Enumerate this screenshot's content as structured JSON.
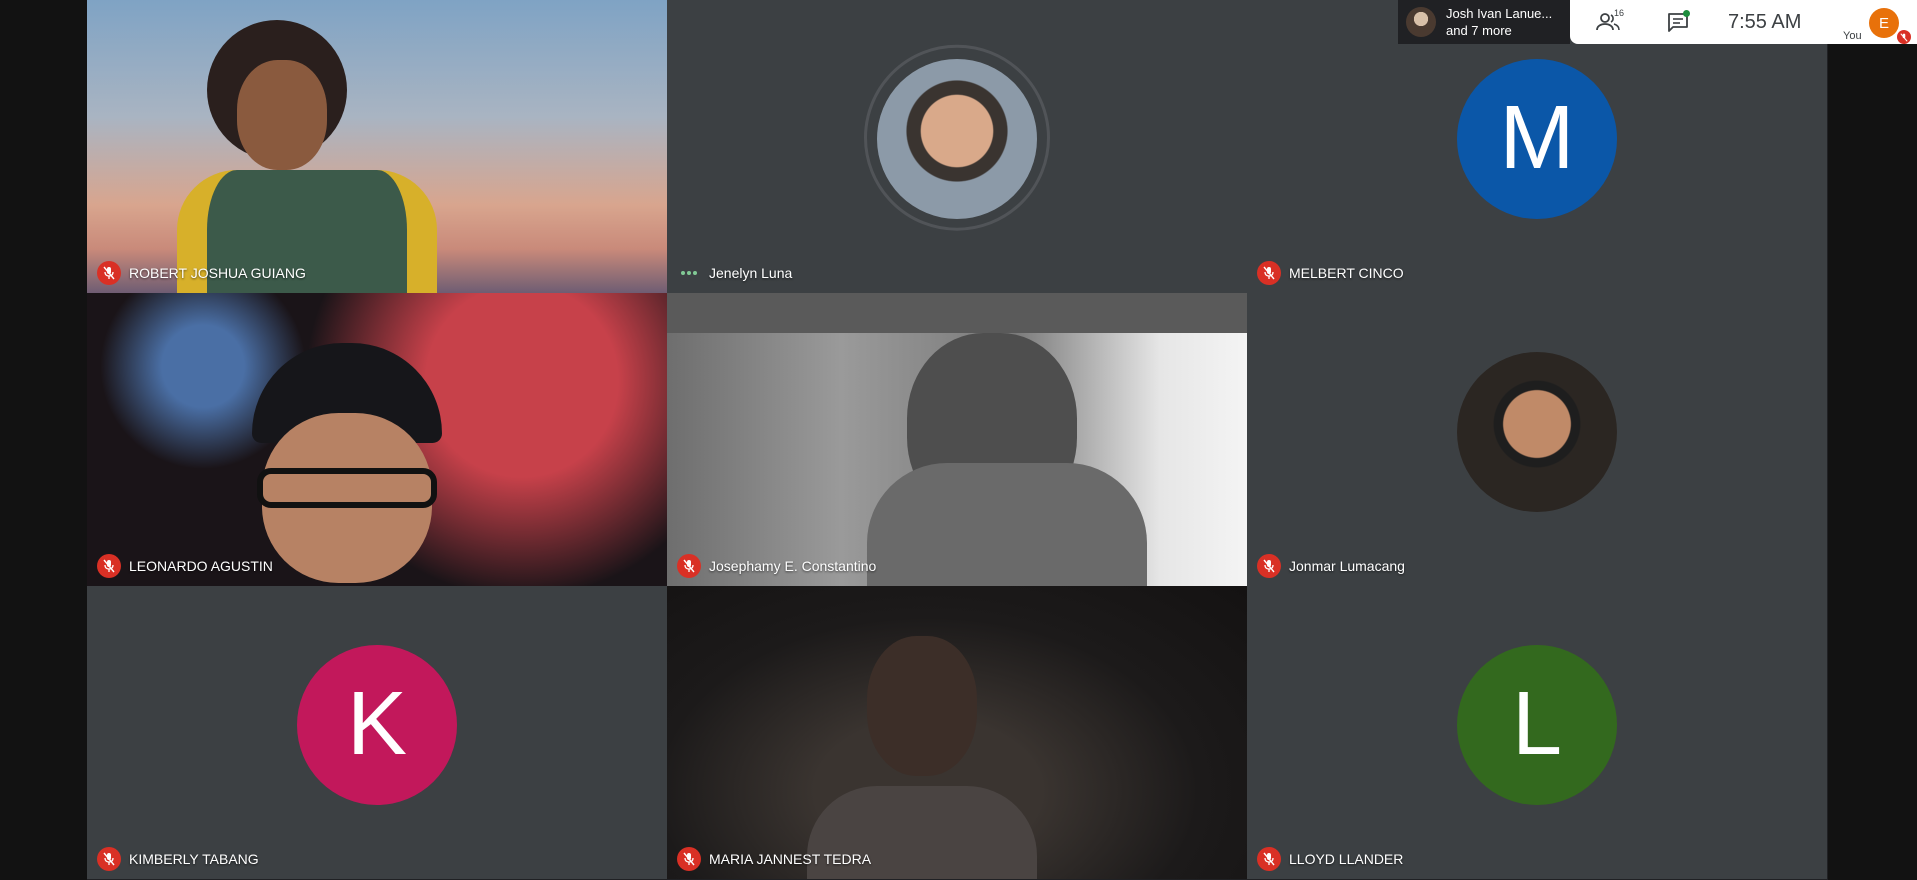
{
  "presenter": {
    "name": "Josh Ivan Lanue...",
    "more": "and 7 more"
  },
  "topbar": {
    "participants_count": "16",
    "time": "7:55 AM",
    "self_initial": "E",
    "self_label": "You"
  },
  "colors": {
    "mic_off": "#d93025",
    "tile_bg": "#3c4043",
    "stage_bg": "#202124"
  },
  "tiles": [
    {
      "name": "ROBERT JOSHUA GUIANG",
      "muted": true,
      "type": "video"
    },
    {
      "name": "Jenelyn Luna",
      "muted": false,
      "type": "photo-avatar"
    },
    {
      "name": "MELBERT CINCO",
      "muted": true,
      "type": "initial",
      "initial": "M",
      "color": "#0b57a8"
    },
    {
      "name": "LEONARDO AGUSTIN",
      "muted": true,
      "type": "video"
    },
    {
      "name": "Josephamy E. Constantino",
      "muted": true,
      "type": "video"
    },
    {
      "name": "Jonmar Lumacang",
      "muted": true,
      "type": "photo-avatar"
    },
    {
      "name": "KIMBERLY TABANG",
      "muted": true,
      "type": "initial",
      "initial": "K",
      "color": "#c2185b"
    },
    {
      "name": "MARIA JANNEST TEDRA",
      "muted": true,
      "type": "video"
    },
    {
      "name": "LLOYD LLANDER",
      "muted": true,
      "type": "initial",
      "initial": "L",
      "color": "#33691e"
    }
  ]
}
